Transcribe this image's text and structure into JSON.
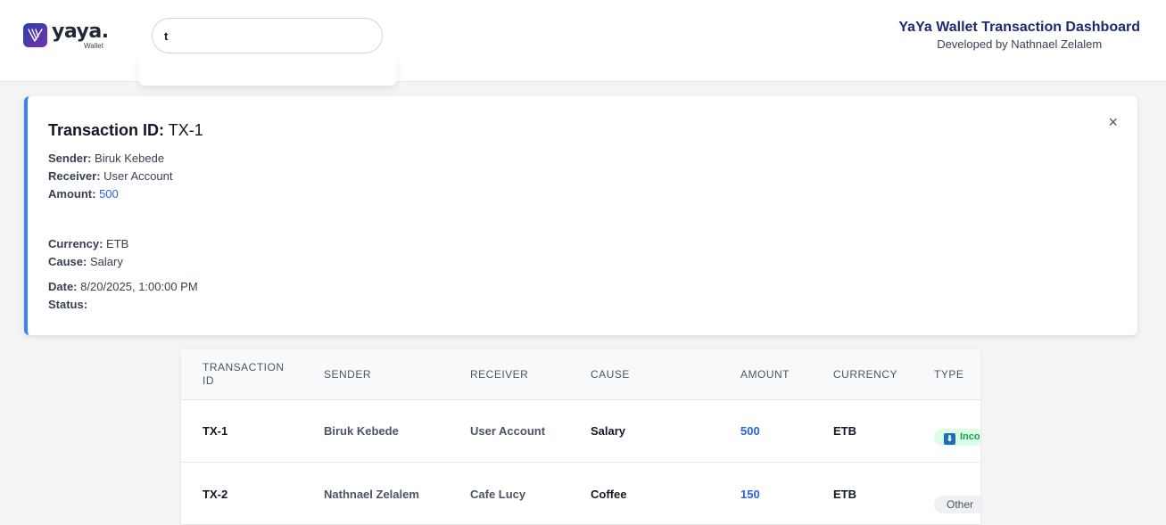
{
  "header": {
    "logo_text": "yaya.",
    "logo_sub": "Wallet",
    "search_value": "t",
    "title": "YaYa Wallet Transaction Dashboard",
    "subtitle": "Developed by Nathnael Zelalem"
  },
  "detail": {
    "title_label": "Transaction ID:",
    "title_value": "TX-1",
    "close_icon": "×",
    "sender_label": "Sender:",
    "sender_value": "Biruk Kebede",
    "receiver_label": "Receiver:",
    "receiver_value": "User Account",
    "amount_label": "Amount:",
    "amount_value": "500",
    "currency_label": "Currency:",
    "currency_value": "ETB",
    "cause_label": "Cause:",
    "cause_value": "Salary",
    "date_label": "Date:",
    "date_value": "8/20/2025, 1:00:00 PM",
    "status_label": "Status:",
    "status_value": ""
  },
  "table": {
    "headers": [
      "TRANSACTION ID",
      "SENDER",
      "RECEIVER",
      "CAUSE",
      "AMOUNT",
      "CURRENCY",
      "TYPE"
    ],
    "rows": [
      {
        "id": "TX-1",
        "sender": "Biruk Kebede",
        "receiver": "User Account",
        "cause": "Salary",
        "amount": "500",
        "currency": "ETB",
        "type": "Inco",
        "type_icon": "⬇"
      },
      {
        "id": "TX-2",
        "sender": "Nathnael Zelalem",
        "receiver": "Cafe Lucy",
        "cause": "Coffee",
        "amount": "150",
        "currency": "ETB",
        "type": "Other"
      }
    ]
  },
  "colors": {
    "accent": "#3b82f6",
    "amount": "#2563eb",
    "brand_title": "#1e2a78",
    "incoming_badge_bg": "#dcfce7",
    "incoming_badge_text": "#16a34a"
  },
  "icons": {
    "logo": "yaya-logo-icon",
    "close": "close-icon",
    "incoming": "arrow-down-icon"
  }
}
